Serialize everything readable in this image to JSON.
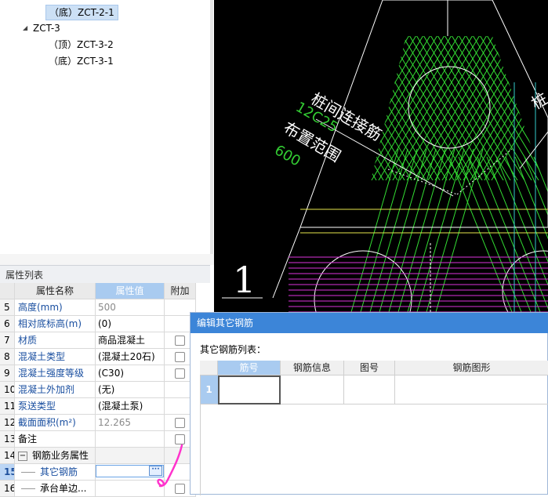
{
  "tree": {
    "nodes": [
      {
        "label": "（底）ZCT-2-1",
        "selected": true
      },
      {
        "label": "ZCT-3",
        "expanded": true
      },
      {
        "label": "（顶）ZCT-3-2"
      },
      {
        "label": "（底）ZCT-3-1"
      }
    ]
  },
  "properties": {
    "panel_title": "属性列表",
    "columns": [
      "属性名称",
      "属性值",
      "附加"
    ],
    "rows": [
      {
        "num": "5",
        "name": "高度(mm)",
        "value": "500",
        "name_blue": true,
        "value_gray": true,
        "has_check": false
      },
      {
        "num": "6",
        "name": "相对底标高(m)",
        "value": "(0)",
        "name_blue": true,
        "value_gray": false,
        "has_check": false
      },
      {
        "num": "7",
        "name": "材质",
        "value": "商品混凝土",
        "name_blue": true,
        "value_gray": false,
        "has_check": true
      },
      {
        "num": "8",
        "name": "混凝土类型",
        "value": "(混凝土20石)",
        "name_blue": true,
        "value_gray": false,
        "has_check": true
      },
      {
        "num": "9",
        "name": "混凝土强度等级",
        "value": "(C30)",
        "name_blue": true,
        "value_gray": false,
        "has_check": true
      },
      {
        "num": "10",
        "name": "混凝土外加剂",
        "value": "(无)",
        "name_blue": true,
        "value_gray": false,
        "has_check": false
      },
      {
        "num": "11",
        "name": "泵送类型",
        "value": "(混凝土泵)",
        "name_blue": true,
        "value_gray": false,
        "has_check": false
      },
      {
        "num": "12",
        "name": "截面面积(m²)",
        "value": "12.265",
        "name_blue": true,
        "value_gray": true,
        "has_check": true
      },
      {
        "num": "13",
        "name": "备注",
        "value": "",
        "name_blue": false,
        "value_gray": false,
        "has_check": true
      },
      {
        "num": "14",
        "name": "钢筋业务属性",
        "value": "",
        "name_blue": false,
        "value_gray": false,
        "has_check": false,
        "group": true,
        "toggle": "−"
      },
      {
        "num": "15",
        "name": "其它钢筋",
        "value": "",
        "name_blue": true,
        "value_gray": false,
        "has_check": false,
        "selected": true,
        "editing": true
      },
      {
        "num": "16",
        "name": "承台单边...",
        "value": "",
        "name_blue": false,
        "value_gray": false,
        "has_check": true
      }
    ],
    "ellipsis_label": "···"
  },
  "cad": {
    "labels": {
      "pile_connection": "桩间连接筋",
      "spec": "12C25",
      "layout_range": "布置范围",
      "range_value": "600",
      "section_number": "1",
      "right_partial": "桩"
    },
    "colors": {
      "hatch_green": "#33dd33",
      "magenta": "#dd33dd",
      "yellow": "#e6e64d",
      "cyan": "#33cccc",
      "white": "#ffffff",
      "text_green": "#33cc33"
    }
  },
  "dialog": {
    "title": "编辑其它钢筋",
    "list_label": "其它钢筋列表：",
    "columns": [
      "筋号",
      "钢筋信息",
      "图号",
      "钢筋图形"
    ],
    "rows": [
      {
        "num": "1",
        "cells": [
          "",
          "",
          "",
          ""
        ]
      }
    ],
    "colors": {
      "title_bar": "#3c85d8",
      "active_header": "#a9cbf0"
    }
  }
}
